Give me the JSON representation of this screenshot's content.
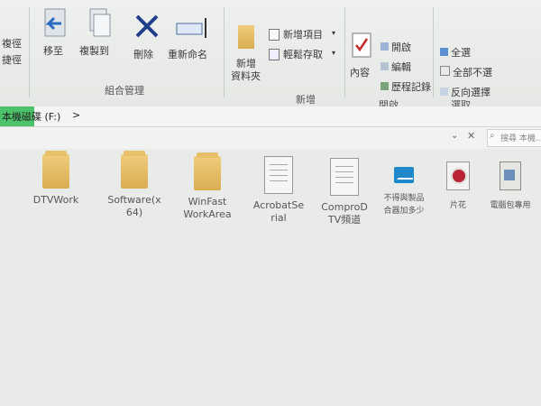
{
  "ribbon": {
    "left_partial_1": "複徑",
    "left_partial_2": "捷徑",
    "move_to": "移至",
    "copy_to": "複製到",
    "delete": "刪除",
    "rename": "重新命名",
    "new_folder_line1": "新增",
    "new_folder_line2": "資料夾",
    "new_item": "新增項目",
    "easy_access": "輕鬆存取",
    "properties": "內容",
    "open": "開啟",
    "edit": "編輯",
    "history": "歷程記錄",
    "select_all": "全選",
    "select_none": "全部不選",
    "invert_selection": "反向選擇",
    "group_organize": "組合管理",
    "group_new": "新增",
    "group_open": "開啟",
    "group_select": "選取"
  },
  "address": {
    "path": "本機磁碟 (F:)",
    "chevron": ">"
  },
  "search": {
    "placeholder": "搜尋 本機..."
  },
  "files": [
    {
      "name_line1": "DTVWork",
      "name_line2": ""
    },
    {
      "name_line1": "Software(x",
      "name_line2": "64)"
    },
    {
      "name_line1": "WinFast",
      "name_line2": "WorkArea"
    },
    {
      "name_line1": "AcrobatSe",
      "name_line2": "rial"
    },
    {
      "name_line1": "ComproD",
      "name_line2": "TV頻道"
    },
    {
      "name_line1": "不得與製品",
      "name_line2": "合器加多少"
    },
    {
      "name_line1": "片花",
      "name_line2": ""
    },
    {
      "name_line1": "電腦包專用",
      "name_line2": ""
    }
  ],
  "colors": {
    "address_highlight": "#4cc36b",
    "delete_icon": "#1f3f8a",
    "folder": "#e6bb61"
  }
}
